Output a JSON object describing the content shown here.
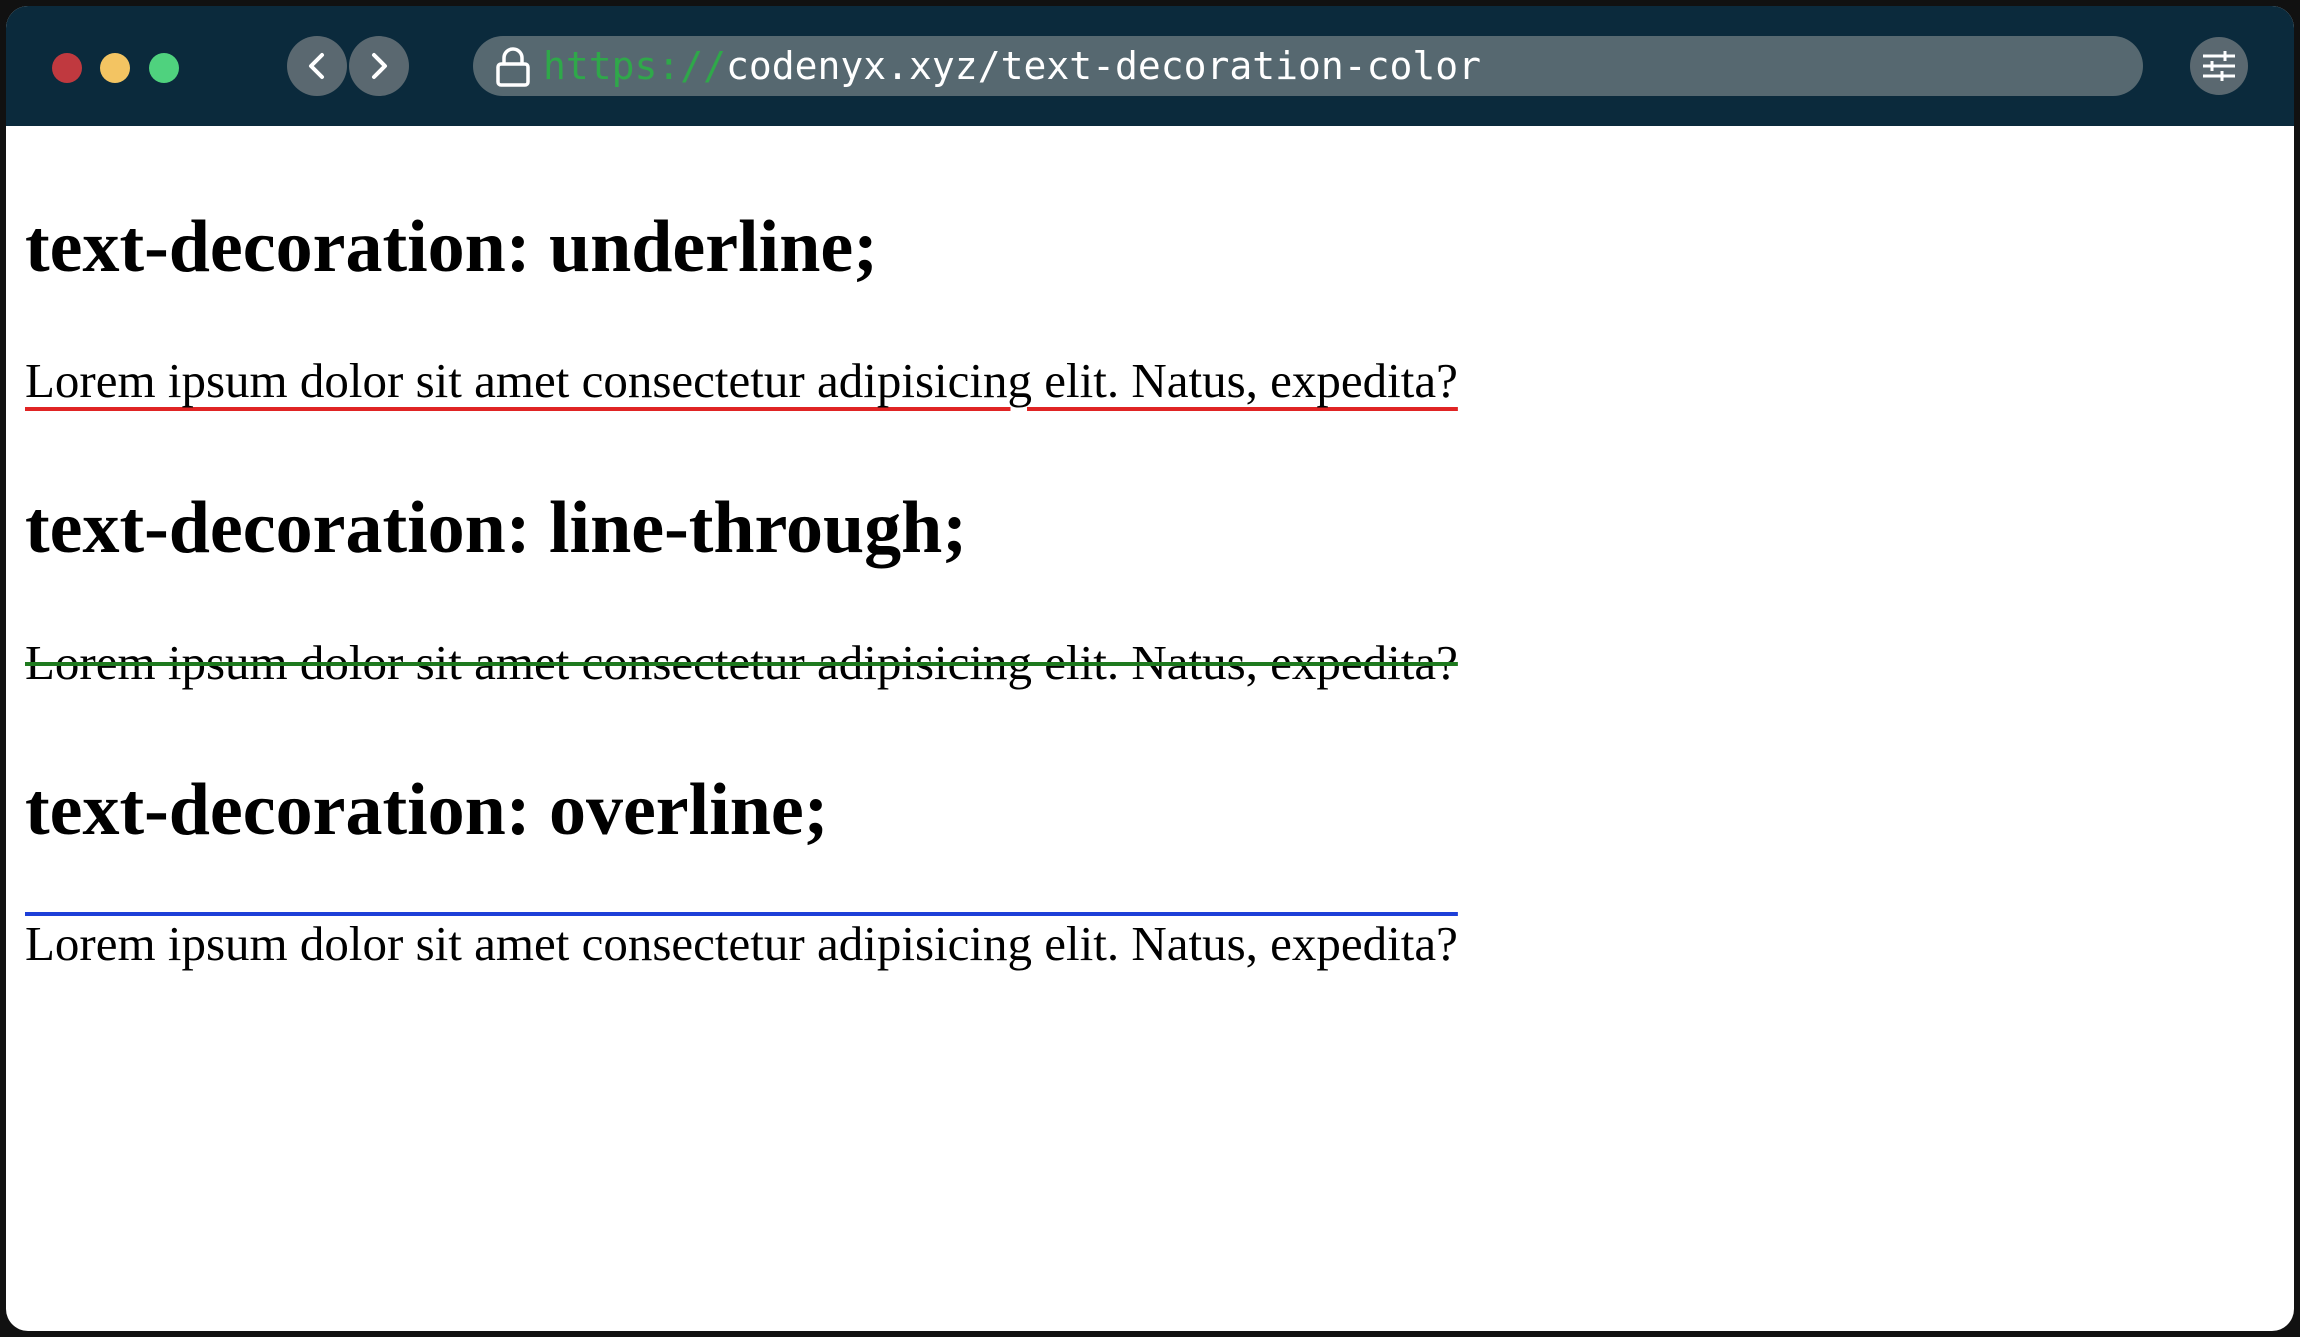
{
  "browser": {
    "url_scheme": "https://",
    "url_rest": "codenyx.xyz/text-decoration-color",
    "traffic_lights": {
      "close": "#c0393f",
      "minimize": "#f3c462",
      "maximize": "#4fd27e"
    },
    "icons": {
      "back": "chevron-left-icon",
      "forward": "chevron-right-icon",
      "lock": "lock-icon",
      "settings": "sliders-icon"
    }
  },
  "sections": [
    {
      "heading": "text-decoration: underline;",
      "paragraph": "Lorem ipsum dolor sit amet consectetur adipisicing elit. Natus, expedita?",
      "decoration": "underline",
      "color": "#e02424"
    },
    {
      "heading": "text-decoration: line-through;",
      "paragraph": "Lorem ipsum dolor sit amet consectetur adipisicing elit. Natus, expedita?",
      "decoration": "line-through",
      "color": "#1e7a1e"
    },
    {
      "heading": "text-decoration: overline;",
      "paragraph": "Lorem ipsum dolor sit amet consectetur adipisicing elit. Natus, expedita?",
      "decoration": "overline",
      "color": "#1d3fd8"
    }
  ]
}
